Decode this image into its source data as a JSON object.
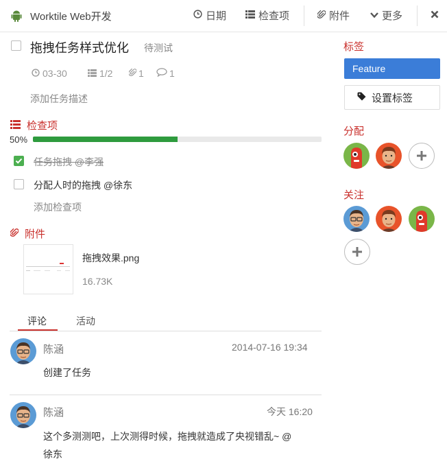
{
  "header": {
    "title": "Worktile Web开发",
    "date_label": "日期",
    "checklist_label": "检查项",
    "attachment_label": "附件",
    "more_label": "更多"
  },
  "task": {
    "title": "拖拽任务样式优化",
    "status": "待测试",
    "due": "03-30",
    "checklist_count": "1/2",
    "attachment_count": "1",
    "comment_count": "1",
    "add_description": "添加任务描述"
  },
  "checklist": {
    "title": "检查项",
    "progress_label": "50%",
    "progress": 0.5,
    "items": [
      {
        "text": "任务拖拽 @李强",
        "done": true
      },
      {
        "text": "分配人时的拖拽 @徐东",
        "done": false
      }
    ],
    "add_label": "添加检查项"
  },
  "attachments": {
    "title": "附件",
    "file_name": "拖拽效果.png",
    "file_size": "16.73K"
  },
  "tabs": [
    {
      "label": "评论",
      "active": true
    },
    {
      "label": "活动",
      "active": false
    }
  ],
  "comments": [
    {
      "author": "陈涵",
      "time": "2014-07-16 19:34",
      "text": "创建了任务"
    },
    {
      "author": "陈涵",
      "time": "今天 16:20",
      "text_line1": "这个多测测吧，上次测得时候，拖拽就造成了央视错乱~ @",
      "text_line2": "徐东"
    }
  ],
  "sidebar": {
    "tags_title": "标签",
    "tag_feature": "Feature",
    "set_tag_label": "设置标签",
    "assign_title": "分配",
    "follow_title": "关注"
  },
  "colors": {
    "accent_red": "#c9302c",
    "feature_blue": "#3b7dd8",
    "progress_green": "#2e9b3e"
  }
}
